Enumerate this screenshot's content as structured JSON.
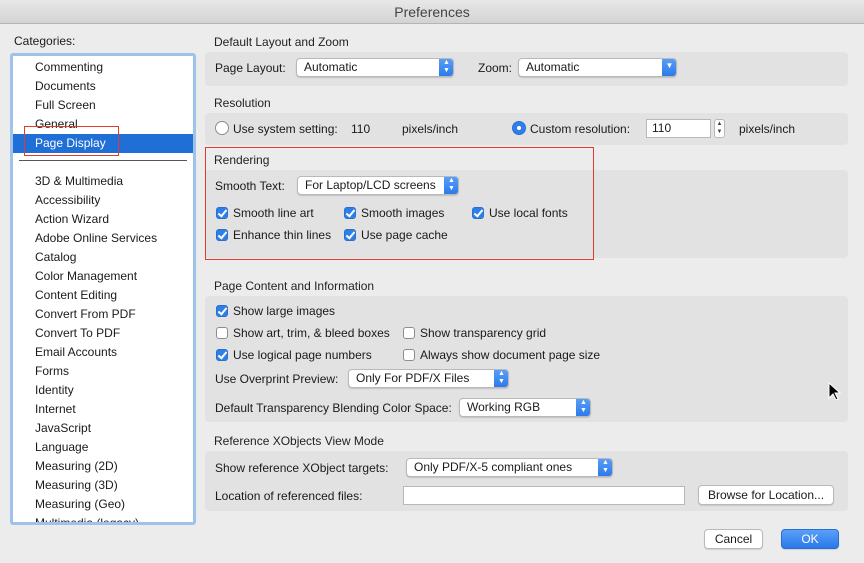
{
  "window": {
    "title": "Preferences"
  },
  "categories": {
    "label": "Categories:",
    "top_items": [
      "Commenting",
      "Documents",
      "Full Screen",
      "General",
      "Page Display"
    ],
    "selected": "Page Display",
    "items": [
      "3D & Multimedia",
      "Accessibility",
      "Action Wizard",
      "Adobe Online Services",
      "Catalog",
      "Color Management",
      "Content Editing",
      "Convert From PDF",
      "Convert To PDF",
      "Email Accounts",
      "Forms",
      "Identity",
      "Internet",
      "JavaScript",
      "Language",
      "Measuring (2D)",
      "Measuring (3D)",
      "Measuring (Geo)",
      "Multimedia (legacy)"
    ]
  },
  "layout_zoom": {
    "title": "Default Layout and Zoom",
    "page_layout_label": "Page Layout:",
    "page_layout_value": "Automatic",
    "zoom_label": "Zoom:",
    "zoom_value": "Automatic"
  },
  "resolution": {
    "title": "Resolution",
    "system_label": "Use system setting:",
    "system_value": "110",
    "system_unit": "pixels/inch",
    "custom_label": "Custom resolution:",
    "custom_value": "110",
    "custom_unit": "pixels/inch",
    "selected": "custom"
  },
  "rendering": {
    "title": "Rendering",
    "smooth_text_label": "Smooth Text:",
    "smooth_text_value": "For Laptop/LCD screens",
    "smooth_line_art": "Smooth line art",
    "smooth_images": "Smooth images",
    "use_local_fonts": "Use local fonts",
    "enhance_thin_lines": "Enhance thin lines",
    "use_page_cache": "Use page cache"
  },
  "page_content": {
    "title": "Page Content and Information",
    "show_large_images": "Show large images",
    "show_art_trim": "Show art, trim, & bleed boxes",
    "show_transparency_grid": "Show transparency grid",
    "use_logical_page_numbers": "Use logical page numbers",
    "always_show_doc_size": "Always show document page size",
    "overprint_label": "Use Overprint Preview:",
    "overprint_value": "Only For PDF/X Files",
    "blending_label": "Default Transparency Blending Color Space:",
    "blending_value": "Working RGB"
  },
  "xobjects": {
    "title": "Reference XObjects View Mode",
    "targets_label": "Show reference XObject targets:",
    "targets_value": "Only PDF/X-5 compliant ones",
    "location_label": "Location of referenced files:",
    "location_value": "",
    "browse_label": "Browse for Location..."
  },
  "footer": {
    "cancel_label": "Cancel",
    "ok_label": "OK"
  },
  "colors": {
    "accent": "#2f7fe8",
    "selection": "#1f6fd6",
    "highlight_outline": "#e23b2b"
  }
}
